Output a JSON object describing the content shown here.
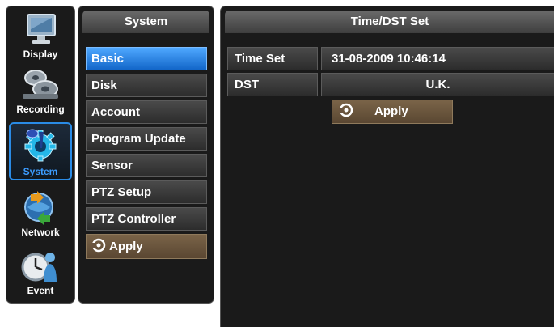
{
  "rail": {
    "items": [
      {
        "label": "Display",
        "icon": "monitor-icon"
      },
      {
        "label": "Recording",
        "icon": "film-reels-icon"
      },
      {
        "label": "System",
        "icon": "gear-icon",
        "active": true
      },
      {
        "label": "Network",
        "icon": "network-arrows-icon"
      },
      {
        "label": "Event",
        "icon": "clock-person-icon"
      }
    ]
  },
  "menu": {
    "title": "System",
    "items": [
      "Basic",
      "Disk",
      "Account",
      "Program Update",
      "Sensor",
      "PTZ Setup",
      "PTZ Controller"
    ],
    "selected": "Basic",
    "apply_label": "Apply"
  },
  "main": {
    "title": "Time/DST Set",
    "time_set_label": "Time Set",
    "time_set_value": "31-08-2009 10:46:14",
    "dst_label": "DST",
    "dst_value": "U.K.",
    "apply_label": "Apply"
  },
  "colors": {
    "accent_blue": "#2a8be6",
    "apply_brown": "#6a5540",
    "panel_bg": "#1a1a1a"
  }
}
